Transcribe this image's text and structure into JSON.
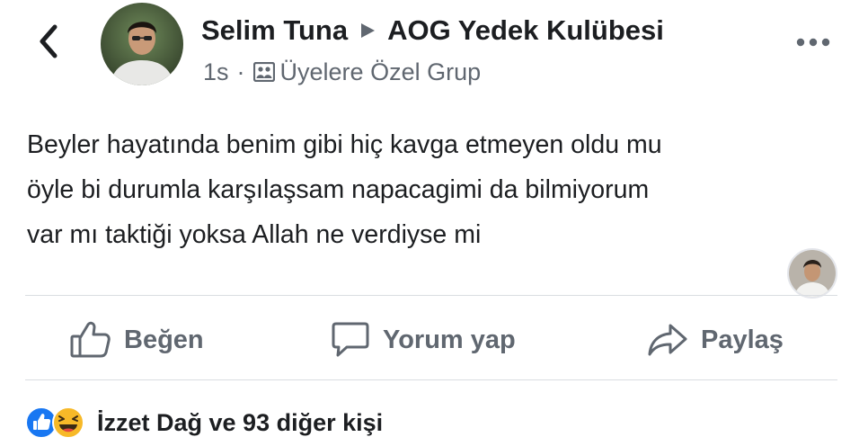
{
  "header": {
    "author": "Selim Tuna",
    "group": "AOG Yedek Kulübesi",
    "time": "1s",
    "separator": "·",
    "privacy": "Üyelere Özel Grup"
  },
  "post": {
    "lines": [
      "Beyler hayatında benim gibi hiç kavga etmeyen oldu mu",
      "öyle bi durumla karşılaşsam napacagimi da bilmiyorum",
      "var mı taktiği yoksa Allah ne verdiyse mi"
    ]
  },
  "actions": {
    "like": "Beğen",
    "comment": "Yorum yap",
    "share": "Paylaş"
  },
  "reactions": {
    "summary": "İzzet Dağ ve 93 diğer kişi",
    "types": [
      "like",
      "haha"
    ]
  },
  "colors": {
    "text": "#1c1e21",
    "secondary": "#606770",
    "like_blue": "#1877f2",
    "haha_yellow": "#f7b928",
    "divider": "#dadde1"
  },
  "icons": [
    "back-chevron-icon",
    "arrow-right-icon",
    "group-icon",
    "more-icon",
    "like-icon",
    "comment-icon",
    "share-icon",
    "like-reaction-icon",
    "haha-reaction-icon"
  ]
}
